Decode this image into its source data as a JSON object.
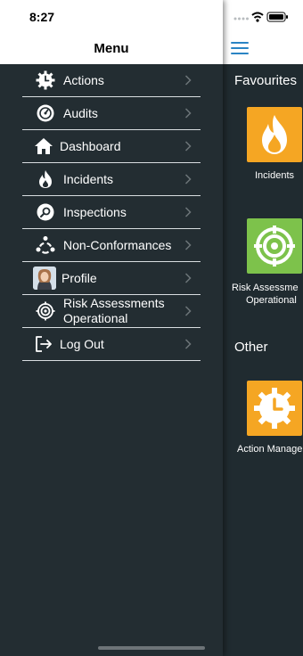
{
  "status_bar": {
    "time": "8:27"
  },
  "drawer": {
    "title": "Menu",
    "items": [
      {
        "label": "Actions",
        "icon": "actions-gear-clock-icon"
      },
      {
        "label": "Audits",
        "icon": "audits-dial-icon"
      },
      {
        "label": "Dashboard",
        "icon": "home-icon"
      },
      {
        "label": "Incidents",
        "icon": "fire-icon"
      },
      {
        "label": "Inspections",
        "icon": "magnifier-icon"
      },
      {
        "label": "Non-Conformances",
        "icon": "non-conformance-icon"
      },
      {
        "label": "Profile",
        "icon": "avatar-photo"
      },
      {
        "label": "Risk Assessments Operational",
        "icon": "target-icon"
      },
      {
        "label": "Log Out",
        "icon": "logout-icon"
      }
    ]
  },
  "main": {
    "favourites_title": "Favourites",
    "other_title": "Other",
    "tiles": [
      {
        "label": "Incidents",
        "color": "#f5a623"
      },
      {
        "label_line1": "Risk Assessme",
        "label_line2": "Operational",
        "color": "#7dc24b"
      },
      {
        "label": "Action Manage",
        "color": "#f5a623"
      }
    ]
  },
  "colors": {
    "accent": "#2a84c4",
    "background": "#202b30"
  }
}
